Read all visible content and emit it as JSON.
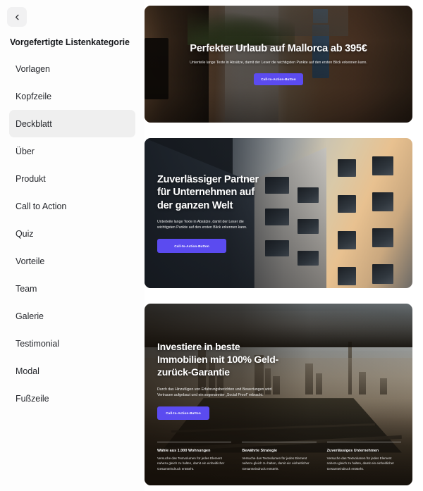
{
  "sidebar": {
    "back_icon": "chevron-left-icon",
    "title": "Vorgefertigte Listenkategorie",
    "items": [
      {
        "label": "Vorlagen",
        "selected": false
      },
      {
        "label": "Kopfzeile",
        "selected": false
      },
      {
        "label": "Deckblatt",
        "selected": true
      },
      {
        "label": "Über",
        "selected": false
      },
      {
        "label": "Produkt",
        "selected": false
      },
      {
        "label": "Call to Action",
        "selected": false
      },
      {
        "label": "Quiz",
        "selected": false
      },
      {
        "label": "Vorteile",
        "selected": false
      },
      {
        "label": "Team",
        "selected": false
      },
      {
        "label": "Galerie",
        "selected": false
      },
      {
        "label": "Testimonial",
        "selected": false
      },
      {
        "label": "Modal",
        "selected": false
      },
      {
        "label": "Fußzeile",
        "selected": false
      }
    ]
  },
  "accent_color": "#5b4bf0",
  "cards": [
    {
      "name": "mallorca-vacation-card",
      "image": "mediterranean-alley-photo",
      "title": "Perfekter Urlaub auf Mallorca ab 395€",
      "subtitle": "Unterteile lange Texte in Absätze, damit der Leser die wichtigsten Punkte auf den ersten Blick erkennen kann.",
      "cta_label": "Call-to-Action-Button",
      "align": "center"
    },
    {
      "name": "reliable-partner-card",
      "image": "modern-office-building-photo",
      "title": "Zuverlässiger Partner für Unternehmen auf der ganzen Welt",
      "subtitle": "Unterteile lange Texte in Absätze, damit der Leser die wichtigsten Punkte auf den ersten Blick erkennen kann.",
      "cta_label": "Call-to-Action-Button",
      "align": "left"
    },
    {
      "name": "real-estate-investment-card",
      "image": "city-skyline-river-photo",
      "title": "Investiere in beste Immobilien mit 100% Geld-zurück-Garantie",
      "subtitle": "Durch das Hinzufügen von Erfahrungsberichten und Bewertungen wird Vertrauen aufgebaut und ein sogenannter „Social Proof“ erbracht.",
      "cta_label": "Call-to-Action-Button",
      "align": "left",
      "features": [
        {
          "heading": "Wähle aus 1.000 Wohnungen",
          "text": "Versuche das Textvolumen für jedes Element nahezu gleich zu halten, damit ein einheitlicher Gesamteindruck entsteht."
        },
        {
          "heading": "Bewährte Strategie",
          "text": "Versuche das Textvolumen für jedes Element nahezu gleich zu halten, damit ein einheitlicher Gesamteindruck entsteht."
        },
        {
          "heading": "Zuverlässiges Unternehmen",
          "text": "Versuche das Textvolumen für jedes Element nahezu gleich zu halten, damit ein einheitlicher Gesamteindruck entsteht."
        }
      ]
    }
  ]
}
